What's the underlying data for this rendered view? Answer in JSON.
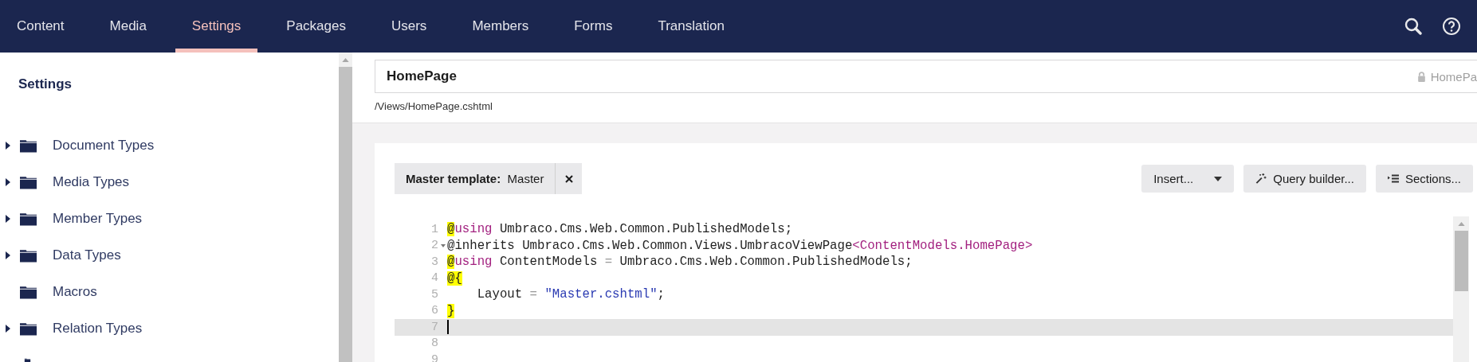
{
  "nav": {
    "sections": [
      {
        "label": "Content",
        "selected": false
      },
      {
        "label": "Media",
        "selected": false
      },
      {
        "label": "Settings",
        "selected": true
      },
      {
        "label": "Packages",
        "selected": false
      },
      {
        "label": "Users",
        "selected": false
      },
      {
        "label": "Members",
        "selected": false
      },
      {
        "label": "Forms",
        "selected": false
      },
      {
        "label": "Translation",
        "selected": false
      }
    ]
  },
  "sidebar": {
    "title": "Settings",
    "items": [
      {
        "label": "Document Types",
        "expandable": true
      },
      {
        "label": "Media Types",
        "expandable": true
      },
      {
        "label": "Member Types",
        "expandable": true
      },
      {
        "label": "Data Types",
        "expandable": true
      },
      {
        "label": "Macros",
        "expandable": false
      },
      {
        "label": "Relation Types",
        "expandable": true
      }
    ]
  },
  "editor": {
    "name": "HomePage",
    "alias": "HomePa",
    "alias_locked": true,
    "path": "/Views/HomePage.cshtml",
    "master_template": {
      "label": "Master template:",
      "value": "Master"
    },
    "toolbar": [
      {
        "label": "Insert...",
        "kind": "dropdown"
      },
      {
        "label": "Query builder...",
        "kind": "wand"
      },
      {
        "label": "Sections...",
        "kind": "sections"
      }
    ],
    "code_lines": [
      {
        "number": "1",
        "fold": false,
        "active": false,
        "tokens": [
          {
            "text": "@",
            "kind": "marker"
          },
          {
            "text": "using",
            "kind": "keyword"
          },
          {
            "text": " Umbraco.Cms.Web.Common.PublishedModels;",
            "kind": "plain"
          }
        ]
      },
      {
        "number": "2",
        "fold": true,
        "active": false,
        "tokens": [
          {
            "text": "@inherits Umbraco.Cms.Web.Common.Views.UmbracoViewPage",
            "kind": "plain"
          },
          {
            "text": "<ContentModels.HomePage>",
            "kind": "type"
          }
        ]
      },
      {
        "number": "3",
        "fold": false,
        "active": false,
        "tokens": [
          {
            "text": "@",
            "kind": "marker"
          },
          {
            "text": "using",
            "kind": "keyword"
          },
          {
            "text": " ContentModels ",
            "kind": "plain"
          },
          {
            "text": "=",
            "kind": "operator"
          },
          {
            "text": " Umbraco.Cms.Web.Common.PublishedModels;",
            "kind": "plain"
          }
        ]
      },
      {
        "number": "4",
        "fold": false,
        "active": false,
        "tokens": [
          {
            "text": "@{",
            "kind": "marker"
          }
        ]
      },
      {
        "number": "5",
        "fold": false,
        "active": false,
        "tokens": [
          {
            "text": "    Layout ",
            "kind": "plain"
          },
          {
            "text": "=",
            "kind": "operator"
          },
          {
            "text": " \"Master.cshtml\"",
            "kind": "string"
          },
          {
            "text": ";",
            "kind": "plain"
          }
        ]
      },
      {
        "number": "6",
        "fold": false,
        "active": false,
        "tokens": [
          {
            "text": "}",
            "kind": "marker"
          }
        ]
      },
      {
        "number": "7",
        "fold": false,
        "active": true
      },
      {
        "number": "8",
        "fold": false,
        "active": false
      },
      {
        "number": "9",
        "fold": false,
        "active": false
      }
    ]
  }
}
